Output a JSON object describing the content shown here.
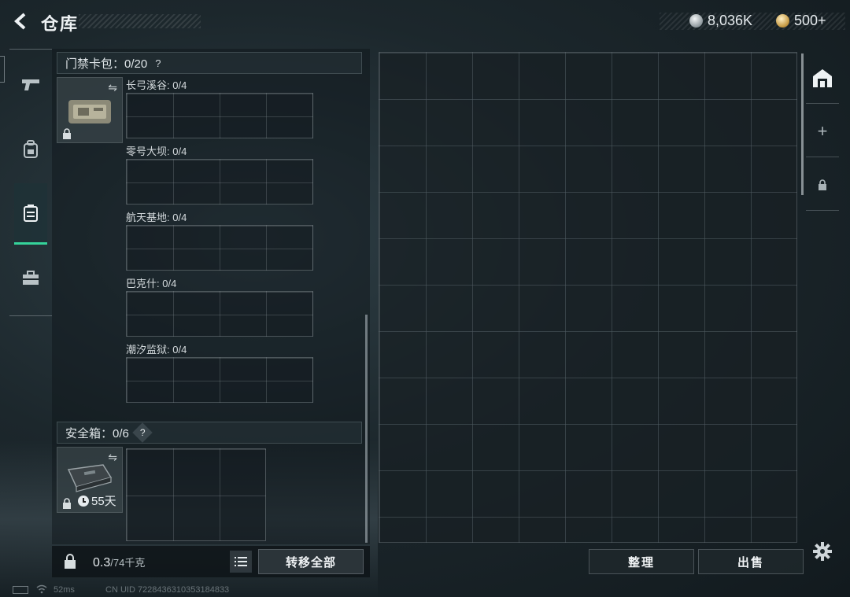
{
  "header": {
    "title": "仓库",
    "silver_amount": "8,036K",
    "gold_amount": "500+"
  },
  "left_nav": {
    "items": [
      {
        "icon": "pistol-icon"
      },
      {
        "icon": "backpack-icon"
      },
      {
        "icon": "container-icon",
        "active": true
      },
      {
        "icon": "briefcase-icon"
      }
    ]
  },
  "keycard_pack": {
    "title": "门禁卡包：0/20",
    "help": "?",
    "zones": [
      {
        "label": "长弓溪谷: 0/4"
      },
      {
        "label": "零号大坝: 0/4"
      },
      {
        "label": "航天基地: 0/4"
      },
      {
        "label": "巴克什: 0/4"
      },
      {
        "label": "潮汐监狱: 0/4"
      }
    ]
  },
  "safe_box": {
    "title": "安全箱：0/6",
    "help": "?",
    "days_left": "55天"
  },
  "bottom_left": {
    "weight_value": "0.3",
    "weight_capacity": "/74千克",
    "transfer_all_label": "转移全部"
  },
  "bottom_right": {
    "sort_label": "整理",
    "sell_label": "出售"
  },
  "status_bar": {
    "ping": "52ms",
    "uid": "CN UID 7228436310353184833"
  },
  "colors": {
    "accent": "#35d39a",
    "background": "#1c272c"
  }
}
